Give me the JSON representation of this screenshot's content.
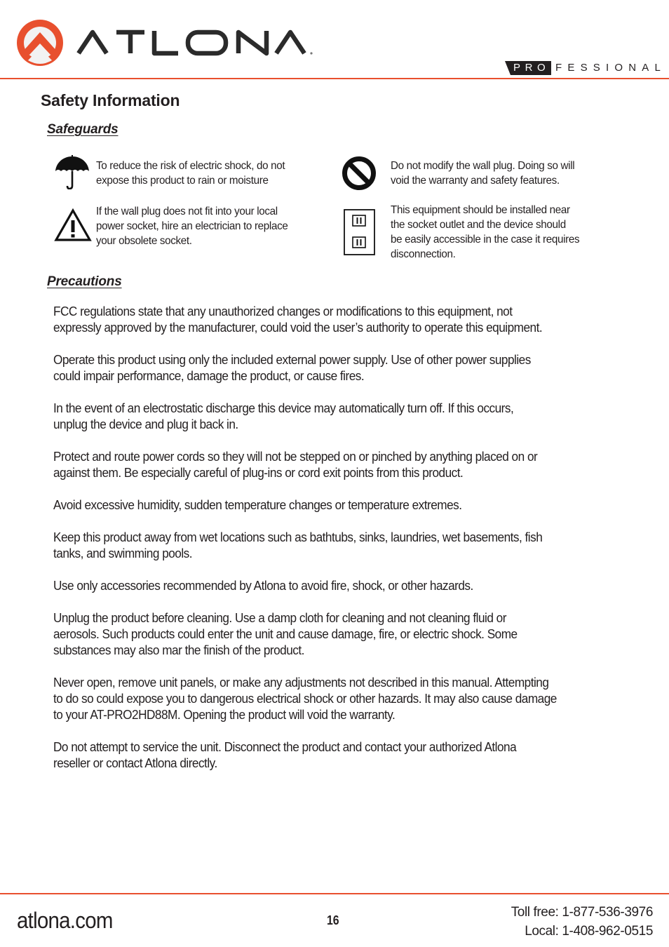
{
  "header": {
    "brand": "ATLONA",
    "tagline_pro": "PRO",
    "tagline_rest": "FESSIONAL",
    "colors": {
      "accent": "#e8502e",
      "text": "#231f20"
    }
  },
  "page_title": "Safety Information",
  "safeguards": {
    "heading": "Safeguards",
    "items": [
      {
        "icon": "umbrella-icon",
        "lines": [
          "To reduce the risk of electric shock, do not",
          "expose this product to rain or moisture"
        ]
      },
      {
        "icon": "no-symbol-icon",
        "lines": [
          "Do not modify the wall plug. Doing so will",
          "void the warranty and safety features."
        ]
      },
      {
        "icon": "warning-triangle-icon",
        "lines": [
          "If the wall plug does not fit into your local",
          "power socket, hire an electrician to replace",
          "your obsolete socket."
        ]
      },
      {
        "icon": "wall-outlet-icon",
        "lines": [
          "This equipment should be installed near",
          "the socket outlet and the device should",
          "be easily accessible in the case it requires",
          "disconnection."
        ]
      }
    ]
  },
  "precautions": {
    "heading": "Precautions",
    "paragraphs": [
      [
        "FCC regulations state that any unauthorized changes or modifications to this equipment, not",
        "expressly approved by the manufacturer, could void the user’s authority to operate this equipment."
      ],
      [
        "Operate this product using only the included external power supply. Use of other power supplies",
        "could impair performance, damage the product, or cause fires."
      ],
      [
        "In the event of an electrostatic discharge this device may automatically turn off. If this occurs,",
        "unplug the device and plug it back in."
      ],
      [
        "Protect and route power cords so they will not be stepped on or pinched by anything placed on or",
        "against them. Be especially careful of plug-ins or cord exit points from this product."
      ],
      [
        "Avoid excessive humidity, sudden temperature changes or temperature extremes."
      ],
      [
        "Keep this product away from wet locations such as bathtubs, sinks, laundries, wet basements, fish",
        "tanks, and swimming pools."
      ],
      [
        "Use only accessories recommended by Atlona to avoid fire, shock, or other hazards."
      ],
      [
        "Unplug the product before cleaning. Use a damp cloth for cleaning and not cleaning fluid or",
        "aerosols. Such products could enter the unit and cause damage, fire, or electric shock. Some",
        "substances may also mar the finish of the product."
      ],
      [
        "Never open, remove unit panels, or make any adjustments not described in this manual. Attempting",
        "to do so could expose you to dangerous electrical shock or other hazards. It may also cause damage",
        "to your AT-PRO2HD88M. Opening the product will void the warranty."
      ],
      [
        "Do not attempt to service the unit. Disconnect the product and contact your authorized Atlona",
        "reseller or contact Atlona directly."
      ]
    ]
  },
  "footer": {
    "site": "atlona.com",
    "page_number": "16",
    "toll_free": "Toll free: 1-877-536-3976",
    "local": "Local: 1-408-962-0515"
  }
}
